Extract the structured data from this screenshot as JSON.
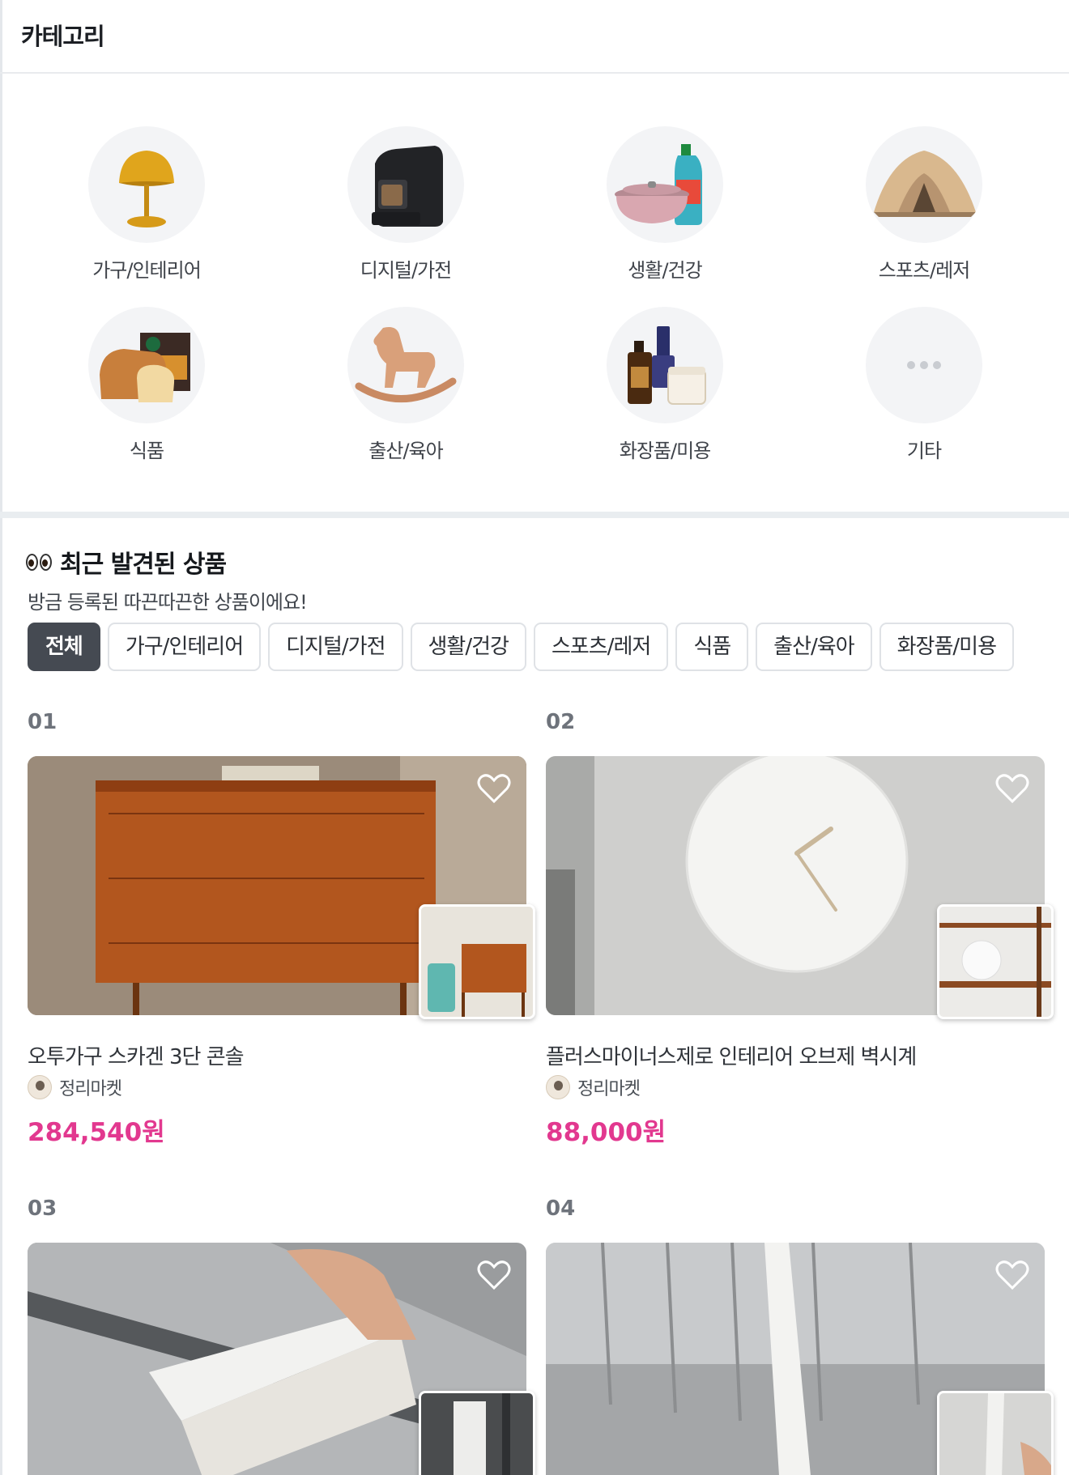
{
  "header": {
    "title": "카테고리"
  },
  "categories": [
    {
      "label": "가구/인테리어",
      "icon": "lamp-icon"
    },
    {
      "label": "디지털/가전",
      "icon": "coffee-machine-icon"
    },
    {
      "label": "생활/건강",
      "icon": "pot-detergent-icon"
    },
    {
      "label": "스포츠/레저",
      "icon": "tent-icon"
    },
    {
      "label": "식품",
      "icon": "bread-coffee-icon"
    },
    {
      "label": "출산/육아",
      "icon": "rocking-horse-icon"
    },
    {
      "label": "화장품/미용",
      "icon": "cosmetics-icon"
    },
    {
      "label": "기타",
      "icon": "more-icon"
    }
  ],
  "recent": {
    "title": "최근 발견된 상품",
    "subtitle": "방금 등록된 따끈따끈한 상품이에요!",
    "chips": [
      "전체",
      "가구/인테리어",
      "디지털/가전",
      "생활/건강",
      "스포츠/레저",
      "식품",
      "출산/육아",
      "화장품/미용"
    ],
    "active_chip": "전체"
  },
  "products": [
    {
      "rank": "01",
      "title": "오투가구 스카겐 3단 콘솔",
      "seller": "정리마켓",
      "price": "284,540원"
    },
    {
      "rank": "02",
      "title": "플러스마이너스제로 인테리어 오브제 벽시계",
      "seller": "정리마켓",
      "price": "88,000원"
    },
    {
      "rank": "03",
      "title": "",
      "seller": "",
      "price": ""
    },
    {
      "rank": "04",
      "title": "",
      "seller": "",
      "price": ""
    }
  ],
  "colors": {
    "price": "#e2388f",
    "active_chip": "#454a52",
    "divider": "#e9edf0"
  }
}
